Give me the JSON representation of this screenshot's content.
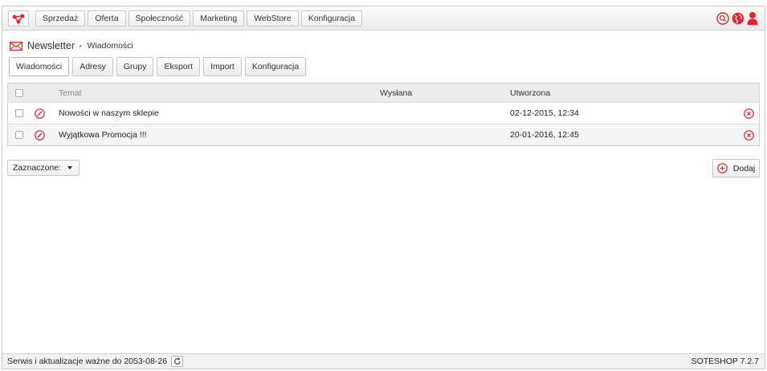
{
  "topbar": {
    "logo_icon": "soteshop-logo-icon",
    "nav": [
      "Sprzedaż",
      "Oferta",
      "Społeczność",
      "Marketing",
      "WebStore",
      "Konfiguracja"
    ],
    "icons": [
      "search-icon",
      "globe-icon",
      "user-icon"
    ]
  },
  "breadcrumb": {
    "icon": "envelope-icon",
    "title": "Newsletter",
    "separator": "▸",
    "current": "Wiadomości"
  },
  "tabs": [
    {
      "label": "Wiadomości",
      "active": true
    },
    {
      "label": "Adresy",
      "active": false
    },
    {
      "label": "Grupy",
      "active": false
    },
    {
      "label": "Eksport",
      "active": false
    },
    {
      "label": "Import",
      "active": false
    },
    {
      "label": "Konfiguracja",
      "active": false
    }
  ],
  "table": {
    "headers": {
      "subject": "Temat",
      "sent": "Wysłana",
      "created": "Utworzona"
    },
    "rows": [
      {
        "subject": "Nowości w naszym sklepie",
        "sent": "",
        "created": "02-12-2015, 12:34"
      },
      {
        "subject": "Wyjątkowa Promocja !!!",
        "sent": "",
        "created": "20-01-2016, 12:45"
      }
    ]
  },
  "selection": {
    "label": "Zaznaczone:"
  },
  "actions": {
    "add_label": "Dodaj"
  },
  "footer": {
    "service_text": "Serwis i aktualizacje ważne do 2053-08-26",
    "version": "SOTESHOP 7.2.7"
  },
  "colors": {
    "accent": "#e0262c",
    "header_bg": "#ececec",
    "alt_row_bg": "#f5f5f5"
  }
}
